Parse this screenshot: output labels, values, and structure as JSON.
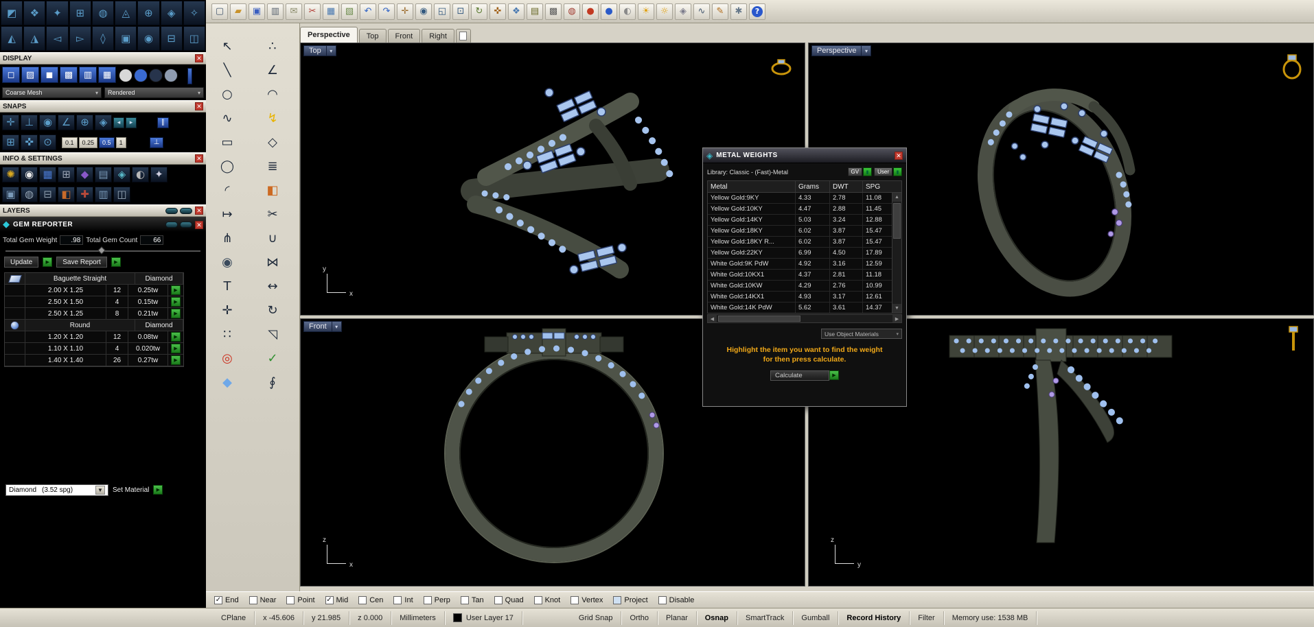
{
  "top_toolbar": {
    "icons": [
      {
        "name": "new-file",
        "glyph": "▢",
        "fg": "#44576e"
      },
      {
        "name": "open-file",
        "glyph": "▰",
        "fg": "#c8922a"
      },
      {
        "name": "save-file",
        "glyph": "▣",
        "fg": "#3a5ec0"
      },
      {
        "name": "print",
        "glyph": "▥",
        "fg": "#5a6470"
      },
      {
        "name": "export-mail",
        "glyph": "✉",
        "fg": "#8a8a6a"
      },
      {
        "name": "cut",
        "glyph": "✂",
        "fg": "#b03a32"
      },
      {
        "name": "copy",
        "glyph": "▦",
        "fg": "#4878b0"
      },
      {
        "name": "paste",
        "glyph": "▧",
        "fg": "#6a8a4a"
      },
      {
        "name": "undo",
        "glyph": "↶",
        "fg": "#2f62c4"
      },
      {
        "name": "redo",
        "glyph": "↷",
        "fg": "#2f62c4"
      },
      {
        "name": "pan-view",
        "glyph": "✛",
        "fg": "#9a6a2a"
      },
      {
        "name": "zoom-dynamic",
        "glyph": "◉",
        "fg": "#33597f"
      },
      {
        "name": "zoom-window",
        "glyph": "◱",
        "fg": "#33597f"
      },
      {
        "name": "zoom-extents",
        "glyph": "⊡",
        "fg": "#33597f"
      },
      {
        "name": "rotate-view",
        "glyph": "↻",
        "fg": "#5a7a30"
      },
      {
        "name": "move-object",
        "glyph": "✜",
        "fg": "#a06018"
      },
      {
        "name": "copy-object",
        "glyph": "❖",
        "fg": "#4878b0"
      },
      {
        "name": "layer-manager",
        "glyph": "▤",
        "fg": "#6a6a2a"
      },
      {
        "name": "object-properties",
        "glyph": "▩",
        "fg": "#5a5a5a"
      },
      {
        "name": "hide-object",
        "glyph": "◍",
        "fg": "#a03a30"
      },
      {
        "name": "render-sphere-red",
        "glyph": "●",
        "fg": "#c23a22"
      },
      {
        "name": "render-sphere-blue",
        "glyph": "●",
        "fg": "#2a5ac8"
      },
      {
        "name": "render-sphere-gray",
        "glyph": "◐",
        "fg": "#8a8a8a"
      },
      {
        "name": "spotlight",
        "glyph": "☀",
        "fg": "#e0a010"
      },
      {
        "name": "lightbulb",
        "glyph": "☼",
        "fg": "#e0a010"
      },
      {
        "name": "lock-object",
        "glyph": "◈",
        "fg": "#7a7a8a"
      },
      {
        "name": "curve-analysis",
        "glyph": "∿",
        "fg": "#44576e"
      },
      {
        "name": "sketch-pencil",
        "glyph": "✎",
        "fg": "#b06a18"
      },
      {
        "name": "settings-gears",
        "glyph": "✱",
        "fg": "#66788a"
      },
      {
        "name": "help",
        "glyph": "?",
        "fg": "#ffffff",
        "bg": "#2a58cc",
        "round": true
      }
    ]
  },
  "corner_toolbar": {
    "icons": [
      {
        "name": "matrix-home-tool",
        "glyph": "◩"
      },
      {
        "name": "gem-studio-tool",
        "glyph": "❖"
      },
      {
        "name": "sparkle-builder-tool",
        "glyph": "✦"
      },
      {
        "name": "grid-builder-tool",
        "glyph": "⊞"
      },
      {
        "name": "halo-tool",
        "glyph": "◍"
      },
      {
        "name": "prong-tool",
        "glyph": "◬"
      },
      {
        "name": "project-gems-tool",
        "glyph": "⊕"
      },
      {
        "name": "diamond-library-tool",
        "glyph": "◈"
      },
      {
        "name": "star-tool",
        "glyph": "✧"
      },
      {
        "name": "loft-builder-tool",
        "glyph": "◭"
      },
      {
        "name": "rail-builder-tool",
        "glyph": "◮"
      },
      {
        "name": "back-tool",
        "glyph": "◅"
      },
      {
        "name": "forward-tool",
        "glyph": "▻"
      },
      {
        "name": "gem-cut-tool",
        "glyph": "◊"
      },
      {
        "name": "panel-layout-tool",
        "glyph": "▣"
      },
      {
        "name": "target-view-tool",
        "glyph": "◉"
      },
      {
        "name": "subtract-tool",
        "glyph": "⊟"
      },
      {
        "name": "window-layout-tool",
        "glyph": "◫"
      }
    ]
  },
  "tool_strip": {
    "icons": [
      {
        "name": "select-pointer",
        "glyph": "↖",
        "fg": "#1f2a3a"
      },
      {
        "name": "edit-control-points",
        "glyph": "∴",
        "fg": "#1f2a3a"
      },
      {
        "name": "line-tool",
        "glyph": "╲",
        "fg": "#1f2a3a"
      },
      {
        "name": "polyline-tool",
        "glyph": "∠",
        "fg": "#1f2a3a"
      },
      {
        "name": "circle-tool",
        "glyph": "○",
        "fg": "#1f2a3a"
      },
      {
        "name": "arc-tool",
        "glyph": "◠",
        "fg": "#1f2a3a"
      },
      {
        "name": "curve-tool",
        "glyph": "∿",
        "fg": "#1f2a3a"
      },
      {
        "name": "flash-render-tool",
        "glyph": "↯",
        "fg": "#e8b300"
      },
      {
        "name": "rectangle-tool",
        "glyph": "▭",
        "fg": "#1f2a3a"
      },
      {
        "name": "polygon-tool",
        "glyph": "◇",
        "fg": "#1f2a3a"
      },
      {
        "name": "ellipse-tool",
        "glyph": "◯",
        "fg": "#1f2a3a"
      },
      {
        "name": "offset-tool",
        "glyph": "≣",
        "fg": "#1f2a3a"
      },
      {
        "name": "fillet-tool",
        "glyph": "◜",
        "fg": "#1f2a3a"
      },
      {
        "name": "paint-tool",
        "glyph": "◧",
        "fg": "#cc6a22"
      },
      {
        "name": "extend-tool",
        "glyph": "↦",
        "fg": "#1f2a3a"
      },
      {
        "name": "trim-tool",
        "glyph": "✂",
        "fg": "#1f2a3a"
      },
      {
        "name": "split-tool",
        "glyph": "⋔",
        "fg": "#1f2a3a"
      },
      {
        "name": "join-tool",
        "glyph": "∪",
        "fg": "#1f2a3a"
      },
      {
        "name": "analyze-magnifier-tool",
        "glyph": "◉",
        "fg": "#3a4a5c"
      },
      {
        "name": "mirror-tool",
        "glyph": "⋈",
        "fg": "#1f2a3a"
      },
      {
        "name": "text-tool",
        "glyph": "T",
        "fg": "#1f2a3a"
      },
      {
        "name": "dimension-tool",
        "glyph": "↔",
        "fg": "#1f2a3a"
      },
      {
        "name": "move-tool",
        "glyph": "✛",
        "fg": "#1f2a3a"
      },
      {
        "name": "rotate-tool",
        "glyph": "↻",
        "fg": "#1f2a3a"
      },
      {
        "name": "array-tool",
        "glyph": "∷",
        "fg": "#1f2a3a"
      },
      {
        "name": "scale-tool",
        "glyph": "◹",
        "fg": "#1f2a3a"
      },
      {
        "name": "target-point-tool",
        "glyph": "◎",
        "fg": "#cc3322"
      },
      {
        "name": "history-check-tool",
        "glyph": "✓",
        "fg": "#2f8f2f"
      },
      {
        "name": "gem-placement-tool",
        "glyph": "◆",
        "fg": "#6fa8e8"
      },
      {
        "name": "sweep-tool",
        "glyph": "∮",
        "fg": "#1f2a3a"
      }
    ]
  },
  "panels": {
    "display": {
      "title": "DISPLAY",
      "mode_icons": [
        {
          "name": "wireframe-display-mode",
          "glyph": "◻"
        },
        {
          "name": "shaded-display-mode",
          "glyph": "▨"
        },
        {
          "name": "rendered-display-mode",
          "glyph": "◼"
        },
        {
          "name": "ghosted-display-mode",
          "glyph": "▩"
        },
        {
          "name": "xray-display-mode",
          "glyph": "▥"
        },
        {
          "name": "flat-display-mode",
          "glyph": "▦"
        }
      ],
      "ball_icons": [
        {
          "name": "display-sphere-white",
          "color": "#d8d8d8"
        },
        {
          "name": "display-sphere-blue",
          "color": "#3a6ad0"
        },
        {
          "name": "display-sphere-dark",
          "color": "#27344c"
        },
        {
          "name": "display-sphere-steel",
          "color": "#8f9cb0"
        }
      ],
      "mesh_select": "Coarse Mesh",
      "render_select": "Rendered"
    },
    "snaps": {
      "title": "SNAPS",
      "row1_icons": [
        {
          "name": "snap-point-tool",
          "glyph": "✛"
        },
        {
          "name": "snap-perpendicular-tool",
          "glyph": "⊥"
        },
        {
          "name": "snap-center-tool",
          "glyph": "◉"
        },
        {
          "name": "snap-angle-tool",
          "glyph": "∠"
        },
        {
          "name": "snap-intersection-tool",
          "glyph": "⊕"
        },
        {
          "name": "snap-vertex-tool",
          "glyph": "◈"
        }
      ],
      "prev_btn": "◂",
      "next_btn": "▸",
      "parallel_btn": "∥",
      "perp_btn": "⊥",
      "row2_icons": [
        {
          "name": "grid-snap-toggle",
          "glyph": "⊞"
        },
        {
          "name": "move-snap-toggle",
          "glyph": "✜"
        },
        {
          "name": "center-snap-toggle",
          "glyph": "⊙"
        }
      ],
      "increments": [
        {
          "label": "0.1"
        },
        {
          "label": "0.25"
        },
        {
          "label": "0.5",
          "active": true
        },
        {
          "label": "1"
        }
      ]
    },
    "info": {
      "title": "INFO & SETTINGS",
      "row1_icons": [
        {
          "name": "gem-info-tool",
          "glyph": "✺",
          "fg": "#d8a820"
        },
        {
          "name": "inspect-tool",
          "glyph": "◉",
          "fg": "#e8e8e8"
        },
        {
          "name": "material-cube-tool",
          "glyph": "▦",
          "fg": "#4878d0"
        },
        {
          "name": "grid-settings-tool",
          "glyph": "⊞",
          "fg": "#9aa4b4"
        },
        {
          "name": "gem-select-tool",
          "glyph": "◆",
          "fg": "#8858c8"
        },
        {
          "name": "report-table-tool",
          "glyph": "▤",
          "fg": "#7a9ab8"
        },
        {
          "name": "diamond-settings-tool",
          "glyph": "◈",
          "fg": "#58b8c8"
        },
        {
          "name": "sphere-settings-tool",
          "glyph": "◐",
          "fg": "#b8b8b8"
        },
        {
          "name": "sparkle-settings-tool",
          "glyph": "✦",
          "fg": "#d0d0e0"
        }
      ],
      "row2_icons": [
        {
          "name": "panel-settings-tool",
          "glyph": "▣",
          "fg": "#7a9ab8"
        },
        {
          "name": "mask-tool",
          "glyph": "◍",
          "fg": "#98a8b8"
        },
        {
          "name": "subtract-settings-tool",
          "glyph": "⊟",
          "fg": "#8a9aaa"
        },
        {
          "name": "shade-settings-tool",
          "glyph": "◧",
          "fg": "#c86a2a"
        },
        {
          "name": "add-settings-tool",
          "glyph": "✚",
          "fg": "#b84a3a"
        },
        {
          "name": "rows-settings-tool",
          "glyph": "▥",
          "fg": "#7a9ab8"
        },
        {
          "name": "column-settings-tool",
          "glyph": "◫",
          "fg": "#98a8b8"
        }
      ]
    },
    "layers": {
      "title": "LAYERS"
    },
    "gem_reporter": {
      "title": "GEM REPORTER",
      "total_weight_label": "Total Gem Weight",
      "total_weight": ".98",
      "total_count_label": "Total Gem Count",
      "total_count": "66",
      "update_label": "Update",
      "save_label": "Save Report",
      "rows": [
        {
          "group": true,
          "icon": "baguette",
          "name": "Baguette Straight",
          "material": "Diamond"
        },
        {
          "size": "2.00 X 1.25",
          "count": "12",
          "weight": "0.25tw"
        },
        {
          "size": "2.50 X 1.50",
          "count": "4",
          "weight": "0.15tw"
        },
        {
          "size": "2.50 X 1.25",
          "count": "8",
          "weight": "0.21tw"
        },
        {
          "group": true,
          "icon": "round",
          "name": "Round",
          "material": "Diamond"
        },
        {
          "size": "1.20 X 1.20",
          "count": "12",
          "weight": "0.08tw"
        },
        {
          "size": "1.10 X 1.10",
          "count": "4",
          "weight": "0.020tw"
        },
        {
          "size": "1.40 X 1.40",
          "count": "26",
          "weight": "0.27tw"
        }
      ],
      "material_value": "Diamond",
      "material_spg": "(3.52 spg)",
      "set_material_label": "Set Material"
    }
  },
  "viewport_tabs": {
    "tabs": [
      {
        "label": "Perspective",
        "active": true
      },
      {
        "label": "Top"
      },
      {
        "label": "Front"
      },
      {
        "label": "Right"
      }
    ]
  },
  "viewports": {
    "top": {
      "label": "Top",
      "axis_v": "y",
      "axis_h": "x"
    },
    "perspective": {
      "label": "Perspective"
    },
    "front": {
      "label": "Front",
      "axis_v": "z",
      "axis_h": "x"
    },
    "right": {
      "axis_v": "z",
      "axis_h": "y"
    }
  },
  "metal_weights": {
    "title": "METAL WEIGHTS",
    "library": "Library: Classic - (Fast)-Metal",
    "gv": "GV",
    "user": "User",
    "columns": [
      "Metal",
      "Grams",
      "DWT",
      "SPG"
    ],
    "rows": [
      {
        "metal": "Yellow Gold:9KY",
        "grams": "4.33",
        "dwt": "2.78",
        "spg": "11.08"
      },
      {
        "metal": "Yellow Gold:10KY",
        "grams": "4.47",
        "dwt": "2.88",
        "spg": "11.45"
      },
      {
        "metal": "Yellow Gold:14KY",
        "grams": "5.03",
        "dwt": "3.24",
        "spg": "12.88"
      },
      {
        "metal": "Yellow Gold:18KY",
        "grams": "6.02",
        "dwt": "3.87",
        "spg": "15.47"
      },
      {
        "metal": "Yellow Gold:18KY R...",
        "grams": "6.02",
        "dwt": "3.87",
        "spg": "15.47"
      },
      {
        "metal": "Yellow Gold:22KY",
        "grams": "6.99",
        "dwt": "4.50",
        "spg": "17.89"
      },
      {
        "metal": "White Gold:9K PdW",
        "grams": "4.92",
        "dwt": "3.16",
        "spg": "12.59"
      },
      {
        "metal": "White Gold:10KX1",
        "grams": "4.37",
        "dwt": "2.81",
        "spg": "11.18"
      },
      {
        "metal": "White Gold:10KW",
        "grams": "4.29",
        "dwt": "2.76",
        "spg": "10.99"
      },
      {
        "metal": "White Gold:14KX1",
        "grams": "4.93",
        "dwt": "3.17",
        "spg": "12.61"
      },
      {
        "metal": "White Gold:14K PdW",
        "grams": "5.62",
        "dwt": "3.61",
        "spg": "14.37"
      }
    ],
    "use_object": "Use Object Materials",
    "hint_line1": "Highlight the item you want to find the weight",
    "hint_line2": "for then press calculate.",
    "calculate": "Calculate"
  },
  "osnap": {
    "items": [
      {
        "label": "End",
        "checked": true
      },
      {
        "label": "Near"
      },
      {
        "label": "Point"
      },
      {
        "label": "Mid",
        "checked": true
      },
      {
        "label": "Cen"
      },
      {
        "label": "Int"
      },
      {
        "label": "Perp"
      },
      {
        "label": "Tan"
      },
      {
        "label": "Quad"
      },
      {
        "label": "Knot"
      },
      {
        "label": "Vertex"
      },
      {
        "label": "Project",
        "tinted": true
      },
      {
        "label": "Disable"
      }
    ]
  },
  "status_bar": {
    "items": [
      {
        "label": "CPlane"
      },
      {
        "label": "x -45.606",
        "inter": "false"
      },
      {
        "label": "y 21.985",
        "inter": "false"
      },
      {
        "label": "z 0.000",
        "inter": "false"
      },
      {
        "label": "Millimeters"
      },
      {
        "label": "User Layer 17",
        "swatch": true
      },
      {
        "label": "Grid Snap",
        "gap": true
      },
      {
        "label": "Ortho"
      },
      {
        "label": "Planar"
      },
      {
        "label": "Osnap",
        "bold": true
      },
      {
        "label": "SmartTrack"
      },
      {
        "label": "Gumball"
      },
      {
        "label": "Record History",
        "bold": true
      },
      {
        "label": "Filter"
      },
      {
        "label": "Memory use: 1538 MB",
        "inter": "false"
      }
    ]
  }
}
